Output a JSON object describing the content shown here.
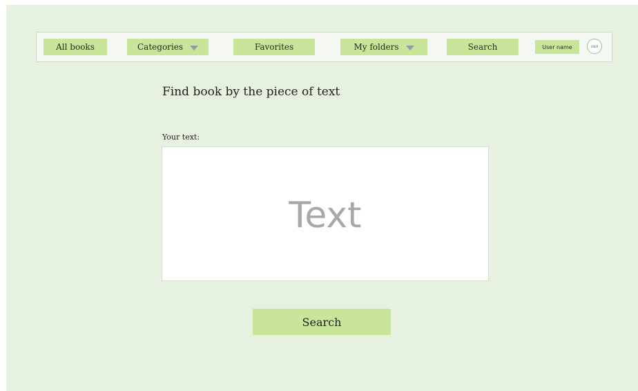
{
  "nav": {
    "all_books": "All books",
    "categories": "Categories",
    "favorites": "Favorites",
    "my_folders": "My folders",
    "search": "Search",
    "user_name": "User name",
    "avatar_label": "USER"
  },
  "main": {
    "title": "Find book by the piece of text",
    "field_label": "Your text:",
    "text_placeholder": "Text",
    "search_button": "Search"
  },
  "colors": {
    "background": "#e6f1df",
    "button": "#c9e59a",
    "navbar": "#f5f8f2",
    "dropdown_arrow": "#8aa0a8"
  },
  "icons": {
    "dropdown": "chevron-down-icon",
    "avatar": "user-avatar-icon"
  }
}
